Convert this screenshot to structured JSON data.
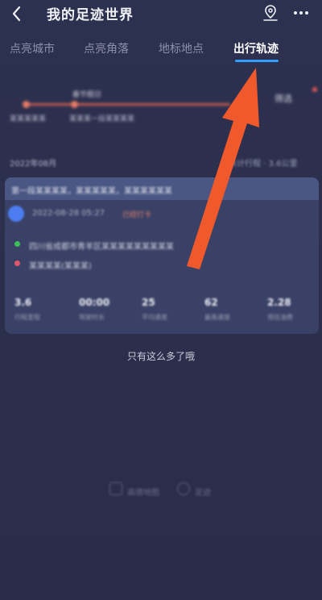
{
  "header": {
    "title": "我的足迹世界",
    "back_icon": "chevron-left-icon",
    "map_icon": "map-pin-icon",
    "more_icon": "more-dots-icon"
  },
  "tabs": [
    {
      "label": "点亮城市",
      "active": false
    },
    {
      "label": "点亮角落",
      "active": false
    },
    {
      "label": "地标地点",
      "active": false
    },
    {
      "label": "出行轨迹",
      "active": true
    }
  ],
  "timeline": {
    "tag": "春节假日",
    "left_label": "某某某某某",
    "mid_label": "某某某一段某某某某",
    "filter_label": "筛选"
  },
  "month": {
    "label": "2022年08月",
    "summary": "共计行程 · 3.6公里"
  },
  "trip_card": {
    "banner": "第一段某某某某，某某某某某，某某某某某某",
    "time": "2022-08-28 05:27",
    "tag": "已经打卡",
    "start_place": "四川省成都市青羊区某某某某某某某某某",
    "end_place": "某某某某(某某某)",
    "stats": [
      {
        "value": "3.6",
        "label": "行程里程"
      },
      {
        "value": "00:00",
        "label": "驾驶时长"
      },
      {
        "value": "25",
        "label": "平均速度"
      },
      {
        "value": "62",
        "label": "最高速度"
      },
      {
        "value": "2.28",
        "label": "预估油费"
      }
    ]
  },
  "end_text": "只有这么多了哦",
  "footer": {
    "left_label": "高德地图",
    "right_label": "足迹"
  },
  "colors": {
    "background": "#2b2f4a",
    "active_tab_underline": "#2f9fff",
    "annotation_arrow": "#f0592b",
    "card_background": "#3a4166"
  }
}
